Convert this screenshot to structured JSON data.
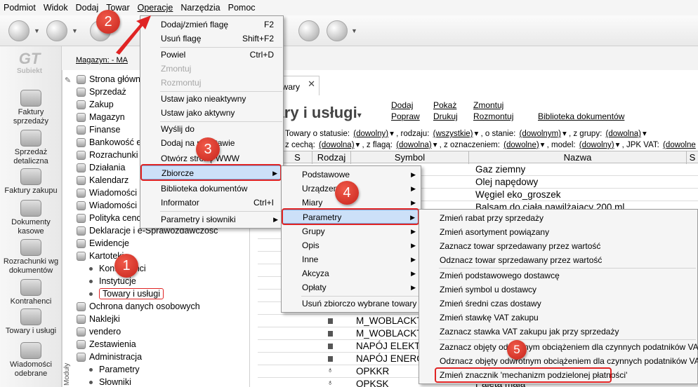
{
  "menubar": [
    "Podmiot",
    "Widok",
    "Dodaj",
    "Towar",
    "Operacje",
    "Narzędzia",
    "Pomoc"
  ],
  "logo": {
    "mark": "GT",
    "name": "Subiekt"
  },
  "sidebar": [
    {
      "label": "Faktury sprzedaży"
    },
    {
      "label": "Sprzedaż detaliczna"
    },
    {
      "label": "Faktury zakupu"
    },
    {
      "label": "Dokumenty kasowe"
    },
    {
      "label": "Rozrachunki wg dokumentów"
    },
    {
      "label": "Kontrahenci"
    },
    {
      "label": "Towary i usługi"
    },
    {
      "label": "Wiadomości odebrane"
    }
  ],
  "magazyn": "Magazyn: - MA",
  "tree": [
    {
      "label": "Strona główna",
      "sub": false
    },
    {
      "label": "Sprzedaż",
      "sub": false
    },
    {
      "label": "Zakup",
      "sub": false
    },
    {
      "label": "Magazyn",
      "sub": false
    },
    {
      "label": "Finanse",
      "sub": false
    },
    {
      "label": "Bankowość el",
      "sub": false
    },
    {
      "label": "Rozrachunki",
      "sub": false
    },
    {
      "label": "Działania",
      "sub": false
    },
    {
      "label": "Kalendarz",
      "sub": false
    },
    {
      "label": "Wiadomości",
      "sub": false
    },
    {
      "label": "Wiadomości S",
      "sub": false
    },
    {
      "label": "Polityka ceno",
      "sub": false
    },
    {
      "label": "Deklaracje i e-Sprawozdawczość",
      "sub": false
    },
    {
      "label": "Ewidencje",
      "sub": false
    },
    {
      "label": "Kartoteki",
      "sub": false
    },
    {
      "label": "Kontrahenci",
      "sub": true
    },
    {
      "label": "Instytucje",
      "sub": true
    },
    {
      "label": "Towary i usługi",
      "sub": true
    },
    {
      "label": "Ochrona danych osobowych",
      "sub": false
    },
    {
      "label": "Naklejki",
      "sub": false
    },
    {
      "label": "vendero",
      "sub": false
    },
    {
      "label": "Zestawienia",
      "sub": false
    },
    {
      "label": "Administracja",
      "sub": false
    },
    {
      "label": "Parametry",
      "sub": true
    },
    {
      "label": "Słowniki",
      "sub": true
    }
  ],
  "vertical_label": "Moduły",
  "tab": {
    "label": "owary"
  },
  "title": "owary i usługi",
  "links": [
    {
      "label": "Dodaj"
    },
    {
      "label": "Pokaż"
    },
    {
      "label": "Zmontuj"
    },
    {
      "label": "Popraw"
    },
    {
      "label": "Drukuj"
    },
    {
      "label": "Rozmontuj"
    },
    {
      "label": "Biblioteka dokumentów"
    }
  ],
  "filters1": "Towary o statusie:",
  "filters1_vals": [
    "(dowolny)",
    ", rodzaju:",
    "(wszystkie)",
    ", o stanie:",
    "(dowolnym)",
    ", z grupy:",
    "(dowolna)"
  ],
  "filters2": "z cechą:",
  "filters2_vals": [
    "(dowolna)",
    ", z flagą:",
    "(dowolna)",
    ", z oznaczeniem:",
    "(dowolne)",
    ", model:",
    "(dowolny)",
    ", JPK VAT:",
    "(dowolne"
  ],
  "columns": [
    "S",
    "Rodzaj",
    "Symbol",
    "Nazwa",
    "S"
  ],
  "rows_top": [
    "Gaz ziemny",
    "Olej napędowy",
    "Węgiel eko_groszek",
    "Balsam do ciała nawilżający 200 ml"
  ],
  "rows_bottom": [
    {
      "symbol": "M_WOBLACKT"
    },
    {
      "symbol": "M_WOBLACKT"
    },
    {
      "symbol": "NAPÓJ ELEKT"
    },
    {
      "symbol": "NAPÓJ ENERC"
    },
    {
      "symbol": "OPKKR"
    },
    {
      "symbol": "OPKSK",
      "name": "Paleta mała"
    }
  ],
  "menu_operacje": [
    {
      "label": "Dodaj/zmień flagę",
      "shortcut": "F2"
    },
    {
      "label": "Usuń flagę",
      "shortcut": "Shift+F2"
    },
    {
      "label": "Powiel",
      "shortcut": "Ctrl+D"
    },
    {
      "label": "Zmontuj",
      "disabled": true
    },
    {
      "label": "Rozmontuj",
      "disabled": true
    },
    {
      "label": "Ustaw jako nieaktywny"
    },
    {
      "label": "Ustaw jako aktywny"
    },
    {
      "label": "Wyślij do"
    },
    {
      "label": "Dodaj na podstawie"
    },
    {
      "label": "Otwórz stronę WWW"
    },
    {
      "label": "Zbiorcze"
    },
    {
      "label": "Biblioteka dokumentów"
    },
    {
      "label": "Informator",
      "shortcut": "Ctrl+I"
    },
    {
      "label": "Parametry i słowniki"
    }
  ],
  "menu_zbiorcze": [
    {
      "label": "Podstawowe"
    },
    {
      "label": "Urządzenia"
    },
    {
      "label": "Miary"
    },
    {
      "label": "Parametry"
    },
    {
      "label": "Grupy"
    },
    {
      "label": "Opis"
    },
    {
      "label": "Inne"
    },
    {
      "label": "Akcyza"
    },
    {
      "label": "Opłaty"
    },
    {
      "label": "Usuń zbiorczo wybrane towary"
    }
  ],
  "menu_parametry": [
    {
      "label": "Zmień rabat przy sprzedaży"
    },
    {
      "label": "Zmień asortyment powiązany"
    },
    {
      "label": "Zaznacz towar sprzedawany przez wartość"
    },
    {
      "label": "Odznacz towar sprzedawany przez wartość"
    },
    {
      "label": "Zmień podstawowego dostawcę"
    },
    {
      "label": "Zmień symbol u dostawcy"
    },
    {
      "label": "Zmień średni czas dostawy"
    },
    {
      "label": "Zmień stawkę VAT zakupu"
    },
    {
      "label": "Zaznacz stawka VAT zakupu jak przy sprzedaży"
    },
    {
      "label": "Zaznacz objęty odwrotnym obciążeniem dla czynnych podatników VAT"
    },
    {
      "label": "Odznacz objęty odwrotnym obciążeniem dla czynnych podatników VAT"
    },
    {
      "label": "Zmień znacznik 'mechanizm podzielonej płatności'"
    }
  ],
  "badges": [
    "1",
    "2",
    "3",
    "4",
    "5"
  ],
  "colors": {
    "callout_red": "#e02424",
    "highlight": "#cce0f8"
  }
}
